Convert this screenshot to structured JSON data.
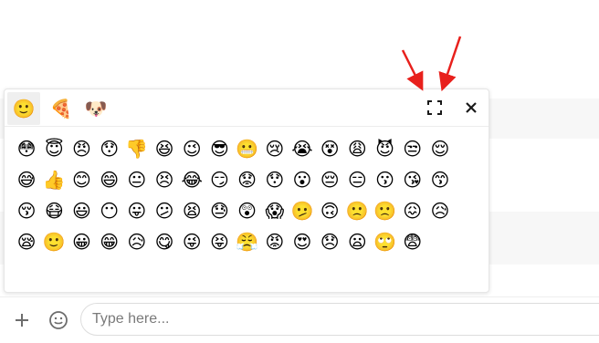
{
  "picker": {
    "categories": [
      {
        "name": "smileys",
        "glyph": "🙂",
        "active": true
      },
      {
        "name": "food",
        "glyph": "🍕",
        "active": false
      },
      {
        "name": "animals",
        "glyph": "🐶",
        "active": false
      }
    ],
    "emojis": [
      "😳",
      "😇",
      "😠",
      "😯",
      "👎",
      "😆",
      "😉",
      "😎",
      "😬",
      "😢",
      "😭",
      "😵",
      "😩",
      "😈",
      "😒",
      "😌",
      "😅",
      "👍",
      "😊",
      "😄",
      "😐",
      "😣",
      "😂",
      "😏",
      "😟",
      "😯",
      "😮",
      "😔",
      "😑",
      "😗",
      "😘",
      "😙",
      "😚",
      "😷",
      "😃",
      "😶",
      "😛",
      "😕",
      "😫",
      "😓",
      "😲",
      "😱",
      "🫤",
      "🙃",
      "🙁",
      "🙁",
      "😖",
      "😥",
      "😪",
      "🙂",
      "😀",
      "😁",
      "😥",
      "😋",
      "😜",
      "😝",
      "😤",
      "😡",
      "😍",
      "😞",
      "😦",
      "🙄",
      "😨"
    ]
  },
  "composer": {
    "placeholder": "Type here..."
  },
  "colors": {
    "annotation_arrow": "#e8201c",
    "icon": "#1a1a1a",
    "composer_icon": "#6d6d6d"
  },
  "icons": {
    "expand": "expand-icon",
    "close": "close-icon",
    "add": "plus-icon",
    "emoji": "smiley-icon"
  }
}
